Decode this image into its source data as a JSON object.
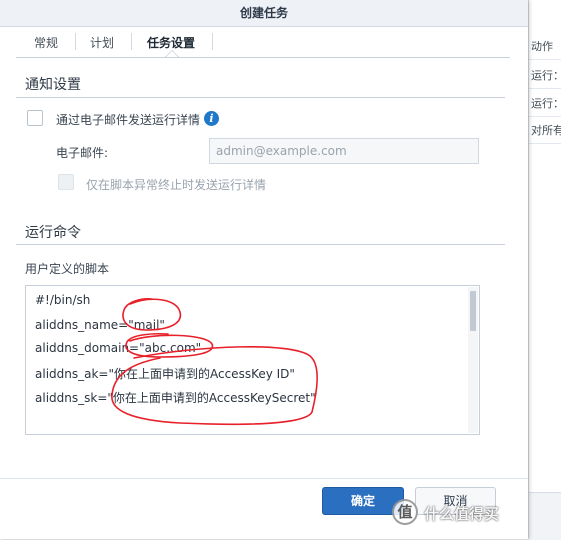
{
  "background": {
    "rows": [
      "动作",
      "运行：",
      "运行：",
      "对所有"
    ]
  },
  "dialog": {
    "title": "创建任务",
    "tabs": [
      {
        "label": "常规",
        "active": false
      },
      {
        "label": "计划",
        "active": false
      },
      {
        "label": "任务设置",
        "active": true
      }
    ],
    "notification": {
      "section_title": "通知设置",
      "send_email_label": "通过电子邮件发送运行详情",
      "send_email_checked": false,
      "email_label": "电子邮件:",
      "email_placeholder": "admin@example.com",
      "only_on_error_label": "仅在脚本异常终止时发送运行详情",
      "only_on_error_checked": false
    },
    "run_command": {
      "section_title": "运行命令",
      "script_label": "用户定义的脚本",
      "script_lines": [
        "#!/bin/sh",
        "aliddns_name=\"mail\"",
        "aliddns_domain=\"abc.com\"",
        "aliddns_ak=\"你在上面申请到的AccessKey ID\"",
        "aliddns_sk=\"你在上面申请到的AccessKeySecret\""
      ]
    },
    "buttons": {
      "ok": "确定",
      "cancel": "取消"
    }
  },
  "annotation": {
    "color": "#e8202a",
    "type": "hand-drawn circles around script values"
  },
  "watermark": {
    "icon_text": "值",
    "text": "什么值得买"
  }
}
